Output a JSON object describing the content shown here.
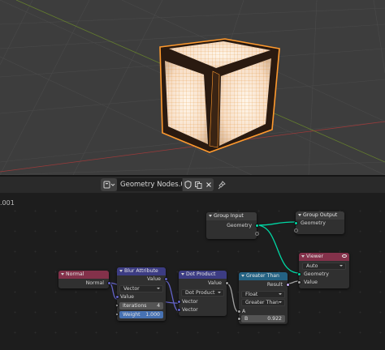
{
  "header": {
    "node_tree_name": "Geometry Nodes.001",
    "editor_icon": "node-editor-icon",
    "fake_user_icon": "shield-icon",
    "copy_icon": "duplicate-icon",
    "close_icon": "close-icon",
    "pin_icon": "pin-icon"
  },
  "breadcrumb": ".001",
  "nodes": {
    "group_input": {
      "title": "Group Input",
      "geometry": "Geometry"
    },
    "group_output": {
      "title": "Group Output",
      "geometry": "Geometry"
    },
    "viewer": {
      "title": "Viewer",
      "domain": "Auto",
      "geometry": "Geometry",
      "value": "Value"
    },
    "normal": {
      "title": "Normal",
      "normal": "Normal"
    },
    "blur": {
      "title": "Blur Attribute",
      "value_out": "Value",
      "type": "Vector",
      "value_in": "Value",
      "iterations_label": "Iterations",
      "iterations": "4",
      "weight_label": "Weight",
      "weight": "1.000"
    },
    "dot": {
      "title": "Dot Product",
      "value_out": "Value",
      "operation": "Dot Product",
      "vector_a": "Vector",
      "vector_b": "Vector"
    },
    "compare": {
      "title": "Greater Than",
      "result": "Result",
      "data_type": "Float",
      "operation": "Greater Than",
      "a": "A",
      "b_label": "B",
      "b": "0.922"
    }
  },
  "colors": {
    "geometry_socket": "#00d6a3",
    "vector_socket": "#6363c7",
    "float_socket": "#a1a1a1",
    "boolean_socket": "#ccb3ff",
    "group_header": "#3b3b3b",
    "input_header": "#83314a",
    "vector_header": "#3c3c83",
    "utility_header": "#246283",
    "selection_outline": "#ff8c1a"
  }
}
